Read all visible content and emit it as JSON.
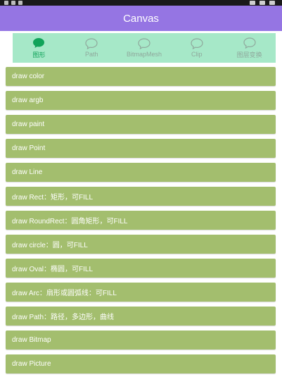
{
  "app": {
    "title": "Canvas"
  },
  "tabs": [
    {
      "label": "图形",
      "icon": "chat-bubble-icon",
      "active": true
    },
    {
      "label": "Path",
      "icon": "chat-bubble-icon",
      "active": false
    },
    {
      "label": "BitmapMesh",
      "icon": "chat-bubble-icon",
      "active": false
    },
    {
      "label": "Clip",
      "icon": "chat-bubble-icon",
      "active": false
    },
    {
      "label": "图层变换",
      "icon": "chat-bubble-icon",
      "active": false
    }
  ],
  "list": {
    "items": [
      "draw color",
      "draw argb",
      "draw paint",
      "draw Point",
      "draw Line",
      "draw Rect：矩形，可FILL",
      "draw RoundRect：圆角矩形，可FILL",
      "draw circle：圆，可FILL",
      "draw Oval：椭圆，可FILL",
      "draw Arc：扇形或圆弧线：可FILL",
      "draw Path：路径，多边形，曲线",
      "draw Bitmap",
      "draw Picture"
    ]
  },
  "colors": {
    "app_bar": "#9575e3",
    "tab_bar": "#a6e8c8",
    "tab_active": "#11a35a",
    "tab_inactive": "#8fa89c",
    "list_item": "#a3be6e"
  }
}
